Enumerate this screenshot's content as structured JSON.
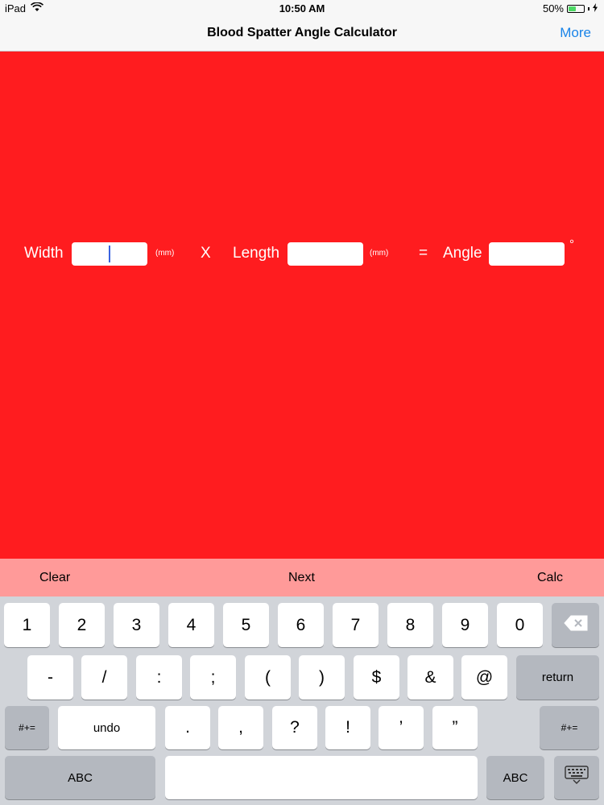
{
  "status_bar": {
    "device": "iPad",
    "time": "10:50 AM",
    "battery_text": "50%",
    "battery_level": 0.5
  },
  "nav": {
    "title": "Blood Spatter Angle Calculator",
    "more_label": "More"
  },
  "calc": {
    "width_label": "Width",
    "width_value": "",
    "width_unit": "(mm)",
    "times_symbol": "X",
    "length_label": "Length",
    "length_value": "",
    "length_unit": "(mm)",
    "equals_symbol": "=",
    "angle_label": "Angle",
    "angle_value": "",
    "degree_symbol": "°"
  },
  "accessory": {
    "clear_label": "Clear",
    "next_label": "Next",
    "calc_label": "Calc"
  },
  "keyboard": {
    "row1": [
      "1",
      "2",
      "3",
      "4",
      "5",
      "6",
      "7",
      "8",
      "9",
      "0"
    ],
    "row2": [
      "-",
      "/",
      ":",
      ";",
      "(",
      ")",
      "$",
      "&",
      "@"
    ],
    "return_label": "return",
    "symbols_label": "#+=",
    "undo_label": "undo",
    "row3": [
      ".",
      ",",
      "?",
      "!",
      "’",
      "”"
    ],
    "abc_label": "ABC"
  },
  "colors": {
    "background": "#ff1c1f",
    "accessory": "#ff9a99",
    "accent": "#1a84e8"
  }
}
